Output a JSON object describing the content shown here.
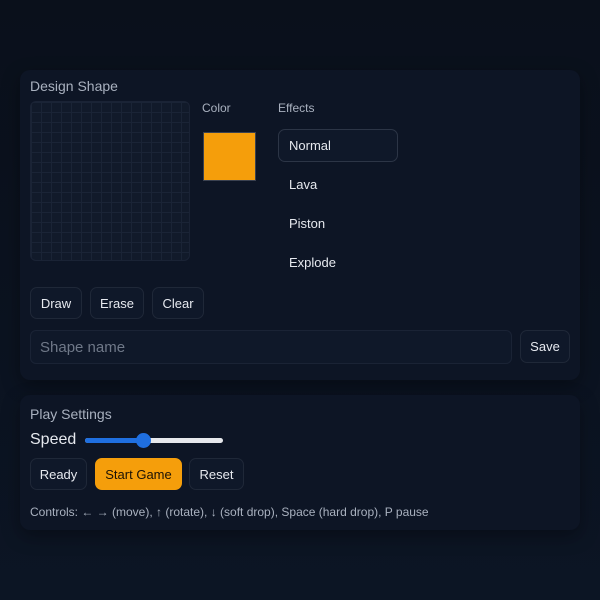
{
  "design": {
    "title": "Design Shape",
    "color_label": "Color",
    "effects_label": "Effects",
    "selected_color": "#f59e0b",
    "effects": [
      {
        "label": "Normal",
        "selected": true
      },
      {
        "label": "Lava",
        "selected": false
      },
      {
        "label": "Piston",
        "selected": false
      },
      {
        "label": "Explode",
        "selected": false
      }
    ],
    "draw_label": "Draw",
    "erase_label": "Erase",
    "clear_label": "Clear",
    "name_placeholder": "Shape name",
    "name_value": "",
    "save_label": "Save"
  },
  "play": {
    "title": "Play Settings",
    "speed_label": "Speed",
    "speed_fraction": 0.42,
    "ready_label": "Ready",
    "start_label": "Start Game",
    "reset_label": "Reset",
    "controls_text": "Controls: ← → (move), ↑ (rotate), ↓ (soft drop), Space (hard drop), P pause"
  },
  "colors": {
    "accent": "#f59e0b",
    "slider": "#1f6fe0"
  }
}
